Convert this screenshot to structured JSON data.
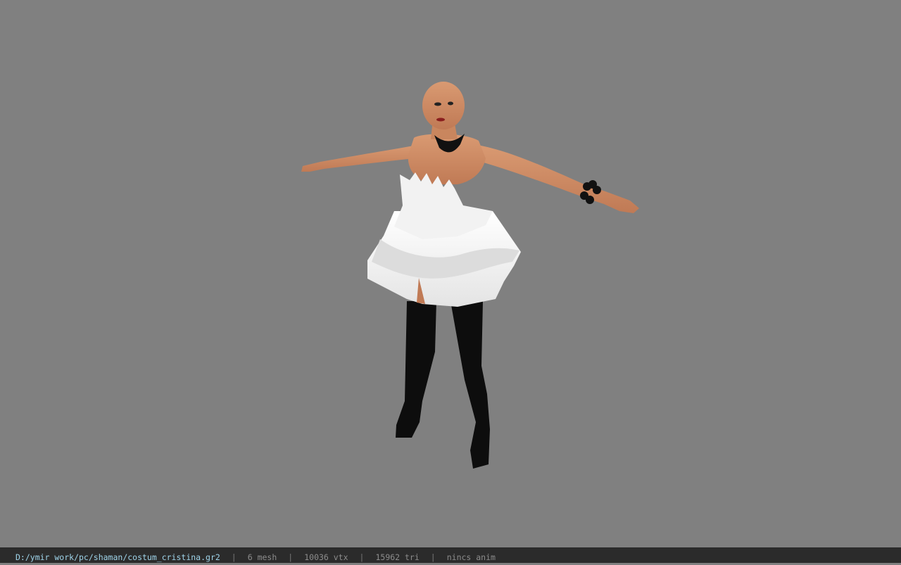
{
  "viewport": {
    "background": "#808080",
    "model": "character-model"
  },
  "statusbar": {
    "file_path": "D:/ymir work/pc/shaman/costum_cristina.gr2",
    "mesh": "6 mesh",
    "vertices": "10036 vtx",
    "triangles": "15962 tri",
    "anim": "nincs anim",
    "separator": "|"
  }
}
